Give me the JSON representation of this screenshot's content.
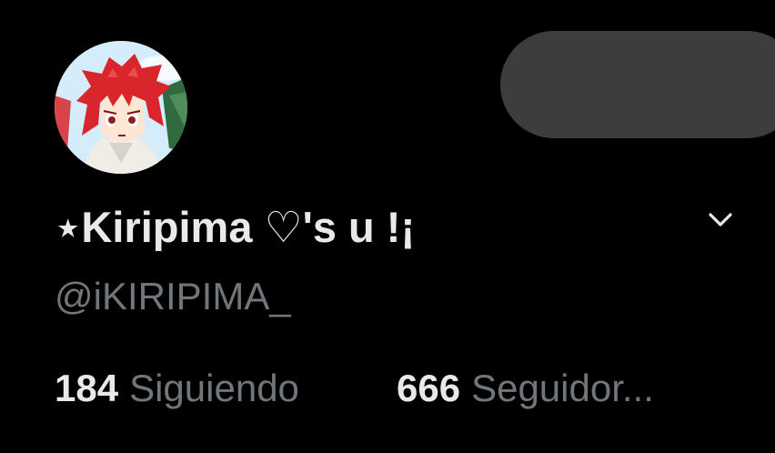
{
  "profile": {
    "avatar": "avatar-image",
    "display_name": "⋆Kiripima ♡'s u !¡",
    "handle": "@iKIRIPIMA_",
    "following_count": "184",
    "following_label": "Siguiendo",
    "followers_count": "666",
    "followers_label": "Seguidor..."
  },
  "icons": {
    "menu": "chevron-down-icon"
  },
  "colors": {
    "background": "#000000",
    "primary_text": "#e7e9ea",
    "secondary_text": "#71767b",
    "button_fill": "#3d3d3d"
  }
}
